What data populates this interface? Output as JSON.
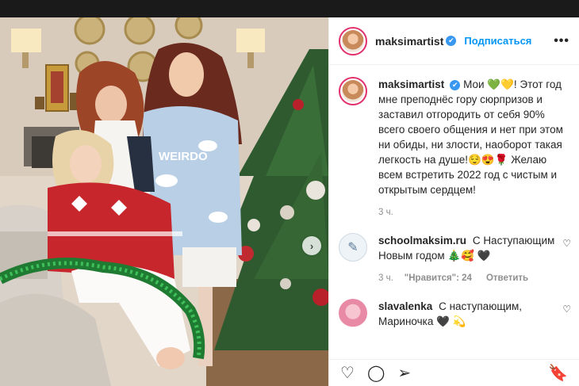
{
  "header": {
    "username": "maksimartist",
    "follow_label": "Подписаться",
    "more_label": "•••"
  },
  "caption": {
    "username": "maksimartist",
    "text": "Мои 💚💛! Этот год мне преподнёс гору сюрпризов и заставил отгородить от себя 90% всего своего общения и нет при этом ни обиды, ни злости, наоборот такая легкость на душе!😌😍🌹 Желаю всем встретить 2022 год с чистым и открытым сердцем!",
    "time": "3 ч."
  },
  "comments": [
    {
      "username": "schoolmaksim.ru",
      "text": "С Наступающим Новым годом 🎄🥰 🖤",
      "time": "3 ч.",
      "likes_label": "\"Нравится\": 24",
      "reply_label": "Ответить"
    },
    {
      "username": "slavalenka",
      "text": "С наступающим, Мариночка 🖤 💫"
    }
  ],
  "icons": {
    "verified": "✔",
    "like": "♡",
    "comment": "◯",
    "share": "➢",
    "save": "🔖",
    "next": "›",
    "small_heart": "♡"
  },
  "colors": {
    "link": "#0095f6",
    "verified": "#3897f0",
    "story_ring": "#e1306c"
  }
}
